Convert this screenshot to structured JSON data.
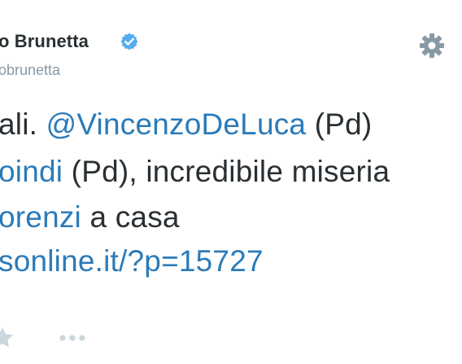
{
  "header": {
    "display_name": "o Brunetta",
    "handle": "obrunetta"
  },
  "icons": {
    "verified": "verified-badge-icon",
    "settings": "gear-icon",
    "favorite": "star-icon",
    "more": "more-dots-icon"
  },
  "tweet": {
    "line1": {
      "prefix": "ali. ",
      "mention": "@VincenzoDeLuca",
      "suffix": " (Pd)"
    },
    "line2": {
      "link": "oindi",
      "suffix": " (Pd), incredibile miseria"
    },
    "line3": {
      "link": "orenzi",
      "suffix": " a casa"
    },
    "line4": {
      "url": "sonline.it/?p=15727"
    }
  },
  "colors": {
    "text": "#292f33",
    "link": "#2b7bb9",
    "secondary": "#8899a6",
    "verified": "#55acee",
    "icon_gray": "#8899a6",
    "action_gray": "#ccd6dd"
  }
}
